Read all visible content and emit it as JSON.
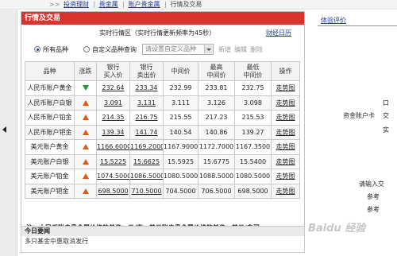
{
  "breadcrumb": {
    "separator": ">>",
    "items": [
      "投资理财",
      "贵金属",
      "账户贵金属"
    ],
    "current": "行情及交易"
  },
  "panel": {
    "title": "行情及交易",
    "refresh_text": "实时行情区（实时行情更新频率为45秒）",
    "finance_link": "财经日历"
  },
  "filter": {
    "option_all": "所有品种",
    "option_custom": "自定义品种查询",
    "select_placeholder": "请设置自定义品种",
    "actions": [
      "新增",
      "编辑",
      "删除"
    ]
  },
  "table": {
    "headers": [
      "品种",
      "涨跌",
      "银行\n买入价",
      "银行\n卖出价",
      "中间价",
      "最高\n中间价",
      "最低\n中间价",
      "操作"
    ],
    "rows": [
      {
        "name": "人民币账户黄金",
        "trend": "down",
        "buy": "232.64",
        "sell": "233.34",
        "mid": "232.99",
        "high": "233.81",
        "low": "232.75",
        "action": "走势图"
      },
      {
        "name": "人民币账户白银",
        "trend": "up",
        "buy": "3.091",
        "sell": "3.131",
        "mid": "3.111",
        "high": "3.126",
        "low": "3.098",
        "action": "走势图"
      },
      {
        "name": "人民币账户铂金",
        "trend": "up",
        "buy": "214.35",
        "sell": "216.75",
        "mid": "215.55",
        "high": "217.23",
        "low": "215.53",
        "action": "走势图"
      },
      {
        "name": "人民币账户钯金",
        "trend": "up",
        "buy": "139.34",
        "sell": "141.74",
        "mid": "140.54",
        "high": "140.86",
        "low": "139.27",
        "action": "走势图"
      },
      {
        "name": "美元账户黄金",
        "trend": "up",
        "buy": "1166.6000",
        "sell": "1169.2000",
        "mid": "1167.9000",
        "high": "1172.7000",
        "low": "1167.3500",
        "action": "走势图"
      },
      {
        "name": "美元账户白银",
        "trend": "up",
        "buy": "15.5225",
        "sell": "15.6625",
        "mid": "15.5925",
        "high": "15.6775",
        "low": "15.5400",
        "action": "走势图"
      },
      {
        "name": "美元账户铂金",
        "trend": "up",
        "buy": "1074.5000",
        "sell": "1086.5000",
        "mid": "1080.5000",
        "high": "1088.5000",
        "low": "1080.5000",
        "action": "走势图"
      },
      {
        "name": "美元账户钯金",
        "trend": "up",
        "buy": "698.5000",
        "sell": "710.5000",
        "mid": "704.5000",
        "high": "706.5000",
        "low": "698.5000",
        "action": "走势图"
      }
    ]
  },
  "note": "注：人民币账户贵金属价格的单位：元/克；美元账户贵金属价格的单位：美元/盎司",
  "news": {
    "title": "今日要闻",
    "items": [
      "多只基金中惠取消发行"
    ]
  },
  "side": {
    "link": "体验评价",
    "texts": [
      "资金账户卡",
      "交",
      "口",
      "实",
      "请输入交",
      "参考",
      "参考"
    ]
  },
  "watermark": "Baidu 经验",
  "colors": {
    "header_red": "#d6342c",
    "link_blue": "#1a3c9a",
    "up_orange": "#e05a10",
    "down_green": "#1f9a2c"
  }
}
